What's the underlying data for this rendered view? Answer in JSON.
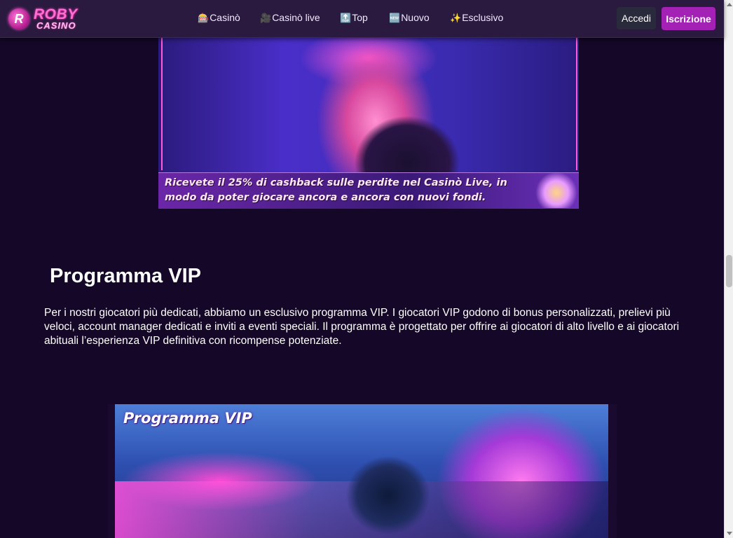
{
  "header": {
    "logo": {
      "line1": "ROBY",
      "line2": "CASINO",
      "badge_letter": "R"
    },
    "nav": [
      {
        "icon": "🎰",
        "label": "Casinò"
      },
      {
        "icon": "🎥",
        "label": "Casinò live"
      },
      {
        "icon": "🔝",
        "label": "Top"
      },
      {
        "icon": "🆕",
        "label": "Nuovo"
      },
      {
        "icon": "✨",
        "label": "Esclusivo"
      }
    ],
    "login_label": "Accedi",
    "register_label": "Iscrizione"
  },
  "banner_live": {
    "caption": "Ricevete il 25% di cashback sulle perdite nel Casinò Live, in modo da poter giocare ancora e ancora con nuovi fondi."
  },
  "vip": {
    "heading": "Programma VIP",
    "paragraph": "Per i nostri giocatori più dedicati, abbiamo un esclusivo programma VIP. I giocatori VIP godono di bonus personalizzati, prelievi più veloci, account manager dedicati e inviti a eventi speciali. Il programma è progettato per offrire ai giocatori di alto livello e ai giocatori abituali l’esperienza VIP definitiva con ricompense potenziate.",
    "banner_title": "Programma VIP"
  },
  "colors": {
    "page_bg": "#150727",
    "header_bg": "#2a1a3f",
    "register_button": "#a321b5",
    "login_button": "#2a2a3d"
  }
}
